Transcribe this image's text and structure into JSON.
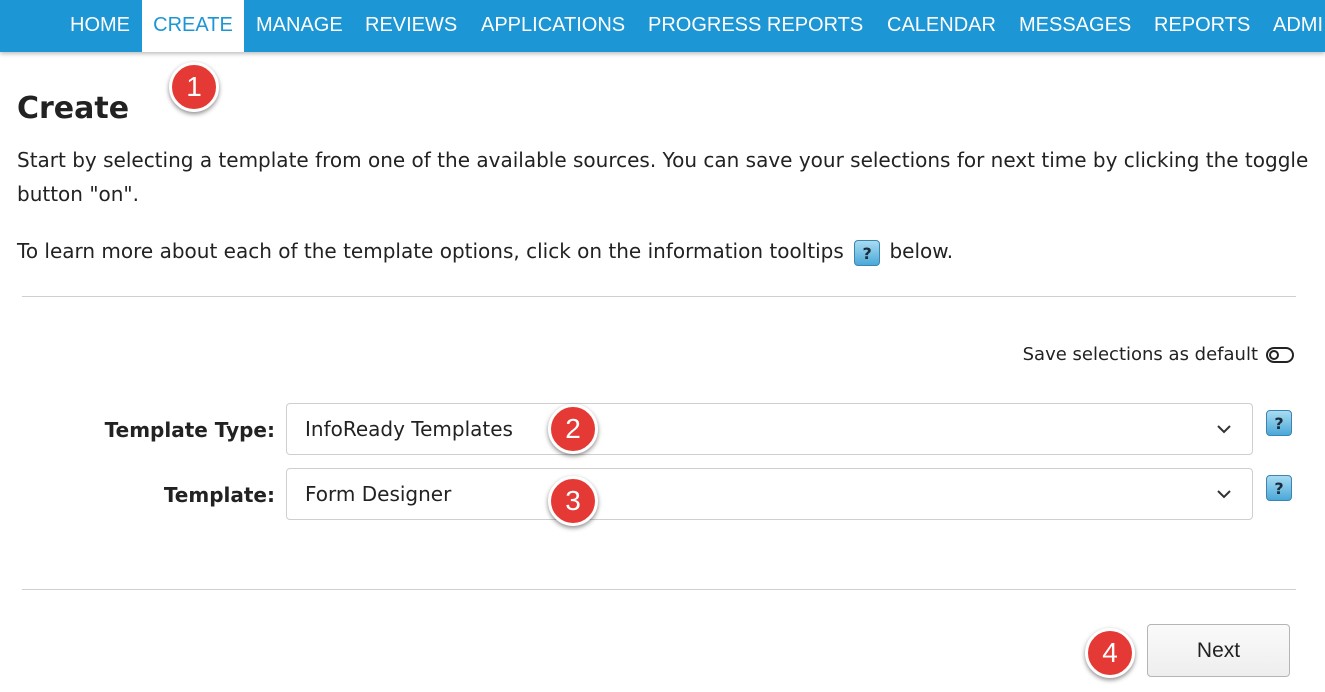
{
  "nav": {
    "items": [
      {
        "label": "HOME"
      },
      {
        "label": "CREATE"
      },
      {
        "label": "MANAGE"
      },
      {
        "label": "REVIEWS"
      },
      {
        "label": "APPLICATIONS"
      },
      {
        "label": "PROGRESS REPORTS"
      },
      {
        "label": "CALENDAR"
      },
      {
        "label": "MESSAGES"
      },
      {
        "label": "REPORTS"
      },
      {
        "label": "ADMI"
      }
    ],
    "active": "CREATE"
  },
  "page": {
    "title": "Create",
    "intro": "Start by selecting a template from one of the available sources. You can save your selections for next time by clicking the toggle button \"on\".",
    "learn_more_before": "To learn more about each of the template options, click on the information tooltips",
    "learn_more_after": "below.",
    "help_glyph": "?"
  },
  "save_default": {
    "label": "Save selections as default",
    "toggle_on": false
  },
  "form": {
    "template_type": {
      "label": "Template Type:",
      "value": "InfoReady Templates"
    },
    "template": {
      "label": "Template:",
      "value": "Form Designer"
    }
  },
  "next_label": "Next",
  "badges": [
    "1",
    "2",
    "3",
    "4"
  ],
  "colors": {
    "nav_bg": "#1c96d4",
    "badge": "#e53935",
    "nav_text": "#ffffff"
  },
  "icons": {
    "dropdown": "chevron-down-icon",
    "help": "question-mark-icon",
    "toggle": "toggle-off-icon"
  }
}
